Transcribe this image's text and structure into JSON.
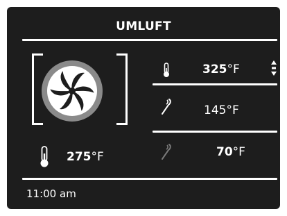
{
  "mode": {
    "title": "UMLUFT"
  },
  "oven_temp": {
    "value": "275",
    "unit": "°F"
  },
  "setpoints": [
    {
      "value": "325",
      "unit": "°F",
      "bold": true
    },
    {
      "value": "145",
      "unit": "°F",
      "bold": false
    },
    {
      "value": "70",
      "unit": "°F",
      "bold": true
    }
  ],
  "clock": {
    "time": "11:00 am"
  },
  "icons": {
    "fan": "convection-fan-icon",
    "thermo": "thermometer-icon",
    "probe": "meat-probe-icon",
    "adjust": "up-down-arrows-icon"
  }
}
